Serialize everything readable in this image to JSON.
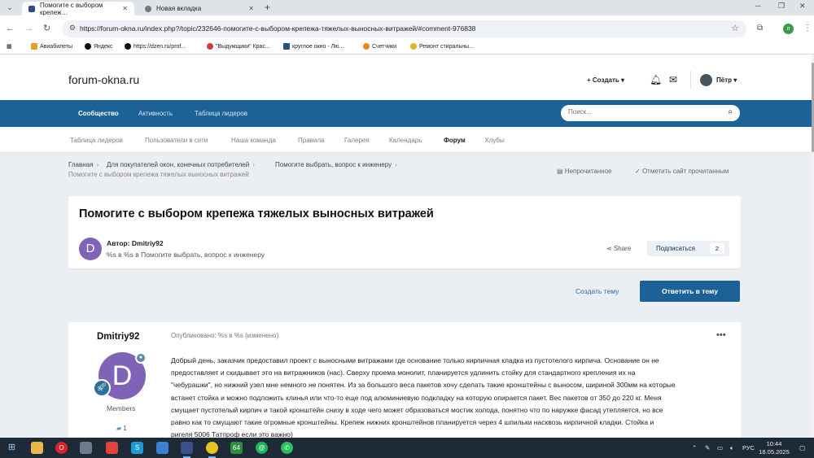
{
  "browser": {
    "tabs": [
      {
        "title": "Помогите с выбором крепеж…",
        "active": true
      },
      {
        "title": "Новая вкладка",
        "active": false
      }
    ],
    "url": "https://forum-okna.ru/index.php?/topic/232646-помогите-с-выбором-крепежа-тяжелых-выносных-витражей/#comment-976838",
    "profile_initial": "п",
    "bookmarks": [
      "Авиабилеты",
      "Яндекс",
      "https://dzen.ru/prof...",
      "\"Выдумщики\" Крас...",
      "круглое окно - Лю...",
      "Счетчики",
      "Ремонт стиральны..."
    ]
  },
  "site": {
    "logo": "forum-okna.ru",
    "create_label": "Создать",
    "user_name": "Пётр",
    "primary_nav": [
      "Сообщество",
      "Активность",
      "Таблица лидеров"
    ],
    "search_placeholder": "Поиск...",
    "secondary_nav": [
      "Таблица лидеров",
      "Пользователи в сети",
      "Наша команда",
      "Правила",
      "Галерея",
      "Календарь",
      "Форум",
      "Клубы"
    ]
  },
  "breadcrumb": {
    "items": [
      "Главная",
      "Для покупателей окон, конечных потребителей",
      "Помогите выбрать, вопрос к инженеру",
      "Помогите с выбором крепежа тяжелых выносных витражей"
    ],
    "unread_label": "Непрочитанное",
    "mark_read_label": "Отметить сайт прочитанным"
  },
  "topic": {
    "title": "Помогите с выбором крепежа тяжелых выносных витражей",
    "avatar_letter": "D",
    "author_line": "Автор: Dmitriy92",
    "sub_line": "%s в %s в Помогите выбрать, вопрос к инженеру",
    "share_label": "Share",
    "follow_label": "Подписаться",
    "follow_count": "2"
  },
  "actions": {
    "create_topic": "Создать тему",
    "reply": "Ответить в тему"
  },
  "post": {
    "author": "Dmitriy92",
    "avatar_letter": "D",
    "group": "Members",
    "post_count": "1",
    "meta": "Опубликовано: %s в %s (изменено)",
    "menu": "•••",
    "body_lines": [
      "Добрый день, заказчик предоставил проект с выносными витражами где основание только кирпичная кладка из пустотелого кирпича. Основание он не",
      "предоставляет и скидывает это на витражников (нас). Сверху проема монолит, планируется удлинить стойку для стандартного крепления их на",
      "\"чебурашки\", но нижний узел мне немного не понятен. Из за большого веса пакетов хочу сделать такие кронштейны с выносом, шириной 300мм на которые",
      "встанет стойка и можно подложить клинья или что-то еще под алюминиевую подкладку на которую опирается пакет. Вес пакетов от 350 до 220 кг. Меня",
      "смущает пустотелый кирпич и такой кронштейн снизу в ходе чего может образоваться мостик холода, понятно что по наружке фасад утепляется, но все",
      "равно как то смущают такие огромные кронштейны. Крепеж нижних кронштейнов планируется через 4 шпильки насквозь кирпичной кладки. Стойка и",
      "ригеля 5006 Татпроф если это важно)"
    ]
  },
  "taskbar": {
    "app_64_label": "64",
    "lang": "РУС",
    "time": "10:44",
    "date": "18.05.2025"
  },
  "colors": {
    "primary_blue": "#1d6296",
    "avatar_purple": "#7e63b6",
    "taskbar": "#1f2a38"
  }
}
